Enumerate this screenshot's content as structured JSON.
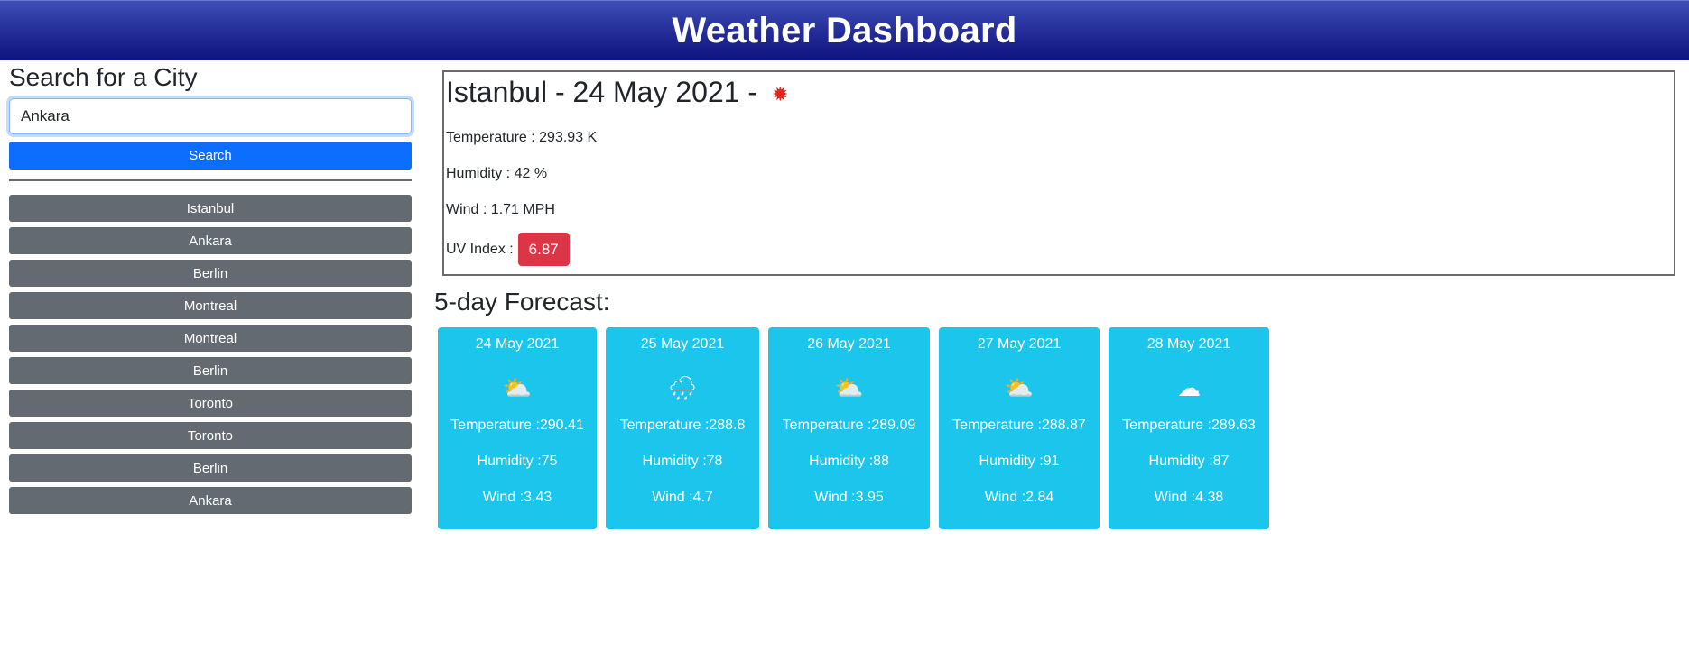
{
  "header": {
    "title": "Weather Dashboard"
  },
  "search": {
    "heading": "Search for a City",
    "input_value": "Ankara",
    "button_label": "Search"
  },
  "history": [
    "Istanbul",
    "Ankara",
    "Berlin",
    "Montreal",
    "Montreal",
    "Berlin",
    "Toronto",
    "Toronto",
    "Berlin",
    "Ankara"
  ],
  "current": {
    "title": "Istanbul - 24 May 2021 -",
    "icon": "sun-icon",
    "temperature": "Temperature : 293.93 K",
    "humidity": "Humidity : 42 %",
    "wind": "Wind : 1.71 MPH",
    "uv_label": "UV Index :",
    "uv_value": "6.87",
    "uv_color": "#dc3545"
  },
  "forecast": {
    "title": "5-day Forecast:",
    "card_color": "#1bc5eb",
    "days": [
      {
        "date": "24 May 2021",
        "icon": "cloud-sun-icon",
        "temp": "Temperature :290.41",
        "humidity": "Humidity :75",
        "wind": "Wind :3.43"
      },
      {
        "date": "25 May 2021",
        "icon": "rain-icon",
        "temp": "Temperature :288.8",
        "humidity": "Humidity :78",
        "wind": "Wind :4.7"
      },
      {
        "date": "26 May 2021",
        "icon": "cloud-sun-icon",
        "temp": "Temperature :289.09",
        "humidity": "Humidity :88",
        "wind": "Wind :3.95"
      },
      {
        "date": "27 May 2021",
        "icon": "cloud-sun-icon",
        "temp": "Temperature :288.87",
        "humidity": "Humidity :91",
        "wind": "Wind :2.84"
      },
      {
        "date": "28 May 2021",
        "icon": "cloud-icon",
        "temp": "Temperature :289.63",
        "humidity": "Humidity :87",
        "wind": "Wind :4.38"
      }
    ]
  }
}
